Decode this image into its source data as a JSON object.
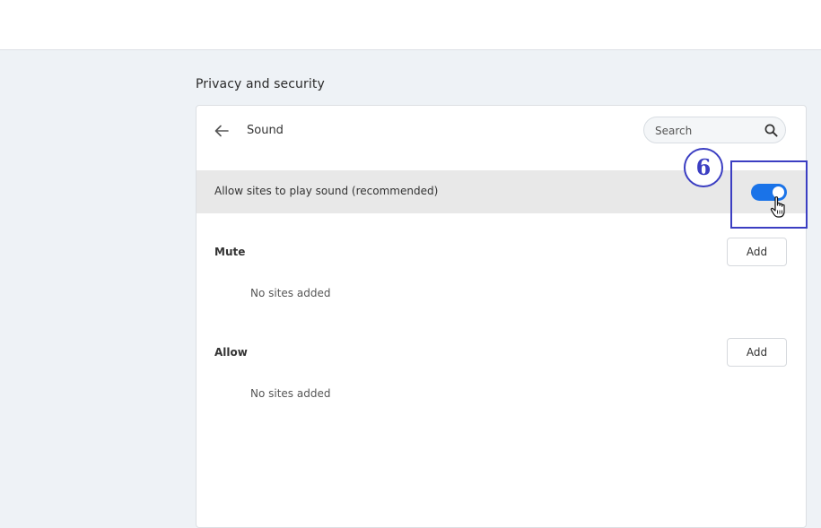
{
  "page": {
    "section_title": "Privacy and security"
  },
  "header": {
    "back_icon": "arrow-left-icon",
    "title": "Sound",
    "search": {
      "placeholder": "Search",
      "value": "",
      "icon": "search-icon"
    }
  },
  "sound_setting": {
    "label": "Allow sites to play sound (recommended)",
    "enabled": true,
    "toggle_color": "#1a73e8"
  },
  "annotation": {
    "step_number": "6",
    "color": "#3b3ec2"
  },
  "groups": [
    {
      "label": "Mute",
      "add_label": "Add",
      "empty_text": "No sites added"
    },
    {
      "label": "Allow",
      "add_label": "Add",
      "empty_text": "No sites added"
    }
  ]
}
